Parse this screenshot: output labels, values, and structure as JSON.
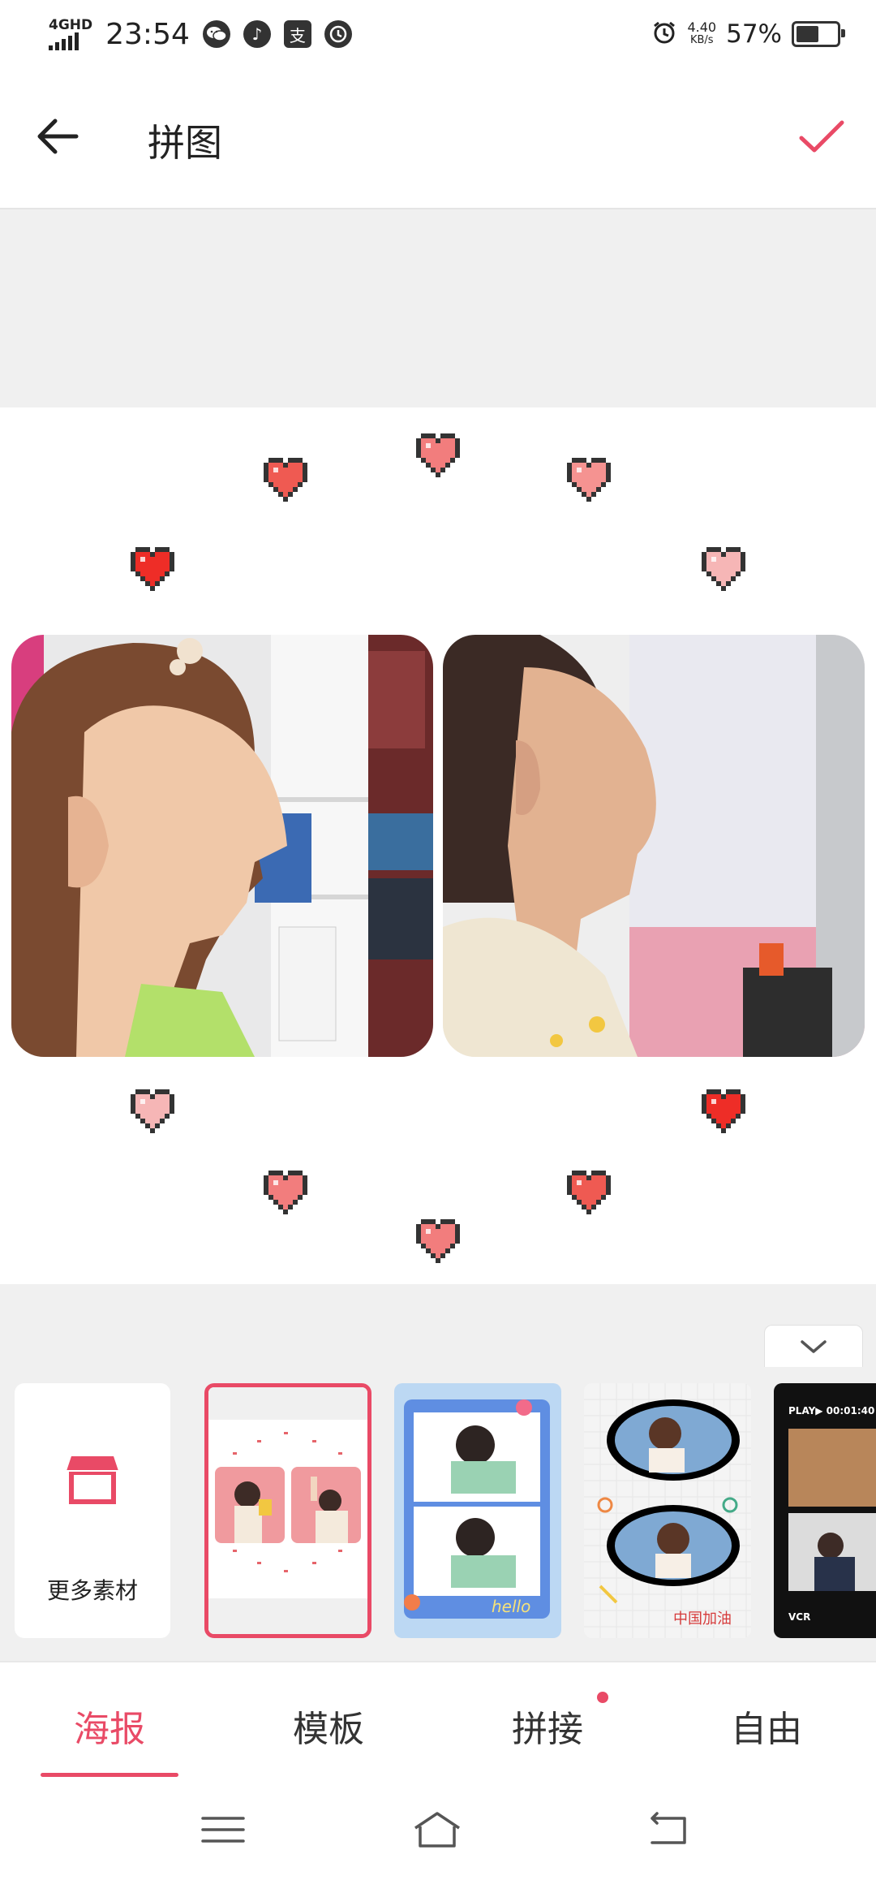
{
  "status_bar": {
    "network": "4GHD",
    "time": "23:54",
    "app_icons": [
      "wechat-icon",
      "music-icon",
      "alipay-icon",
      "clock-icon"
    ],
    "alipay_glyph": "支",
    "alarm_icon": "alarm-icon",
    "speed_value": "4.40",
    "speed_unit": "KB/s",
    "battery_percent": "57%",
    "battery_level": 0.57
  },
  "header": {
    "title": "拼图",
    "back_icon": "arrow-left-icon",
    "confirm_icon": "checkmark-icon"
  },
  "more_materials": {
    "label": "更多素材",
    "icon": "store-icon"
  },
  "templates": [
    {
      "name": "hearts-poster",
      "selected": true
    },
    {
      "name": "hello-blue-frame",
      "selected": false,
      "text": "hello"
    },
    {
      "name": "doodle-frame",
      "selected": false,
      "text": "中国加油"
    },
    {
      "name": "vcr-film",
      "selected": false,
      "text_top": "PLAY▶ 00:01:40",
      "text_bottom": "VCR"
    }
  ],
  "tabs": [
    {
      "label": "海报",
      "active": true
    },
    {
      "label": "模板",
      "active": false
    },
    {
      "label": "拼接",
      "active": false,
      "badge": true
    },
    {
      "label": "自由",
      "active": false
    }
  ],
  "navbar": {
    "items": [
      "menu-icon",
      "home-icon",
      "back-icon"
    ]
  },
  "colors": {
    "accent": "#e94a66",
    "background_gray": "#f0f0f0"
  }
}
